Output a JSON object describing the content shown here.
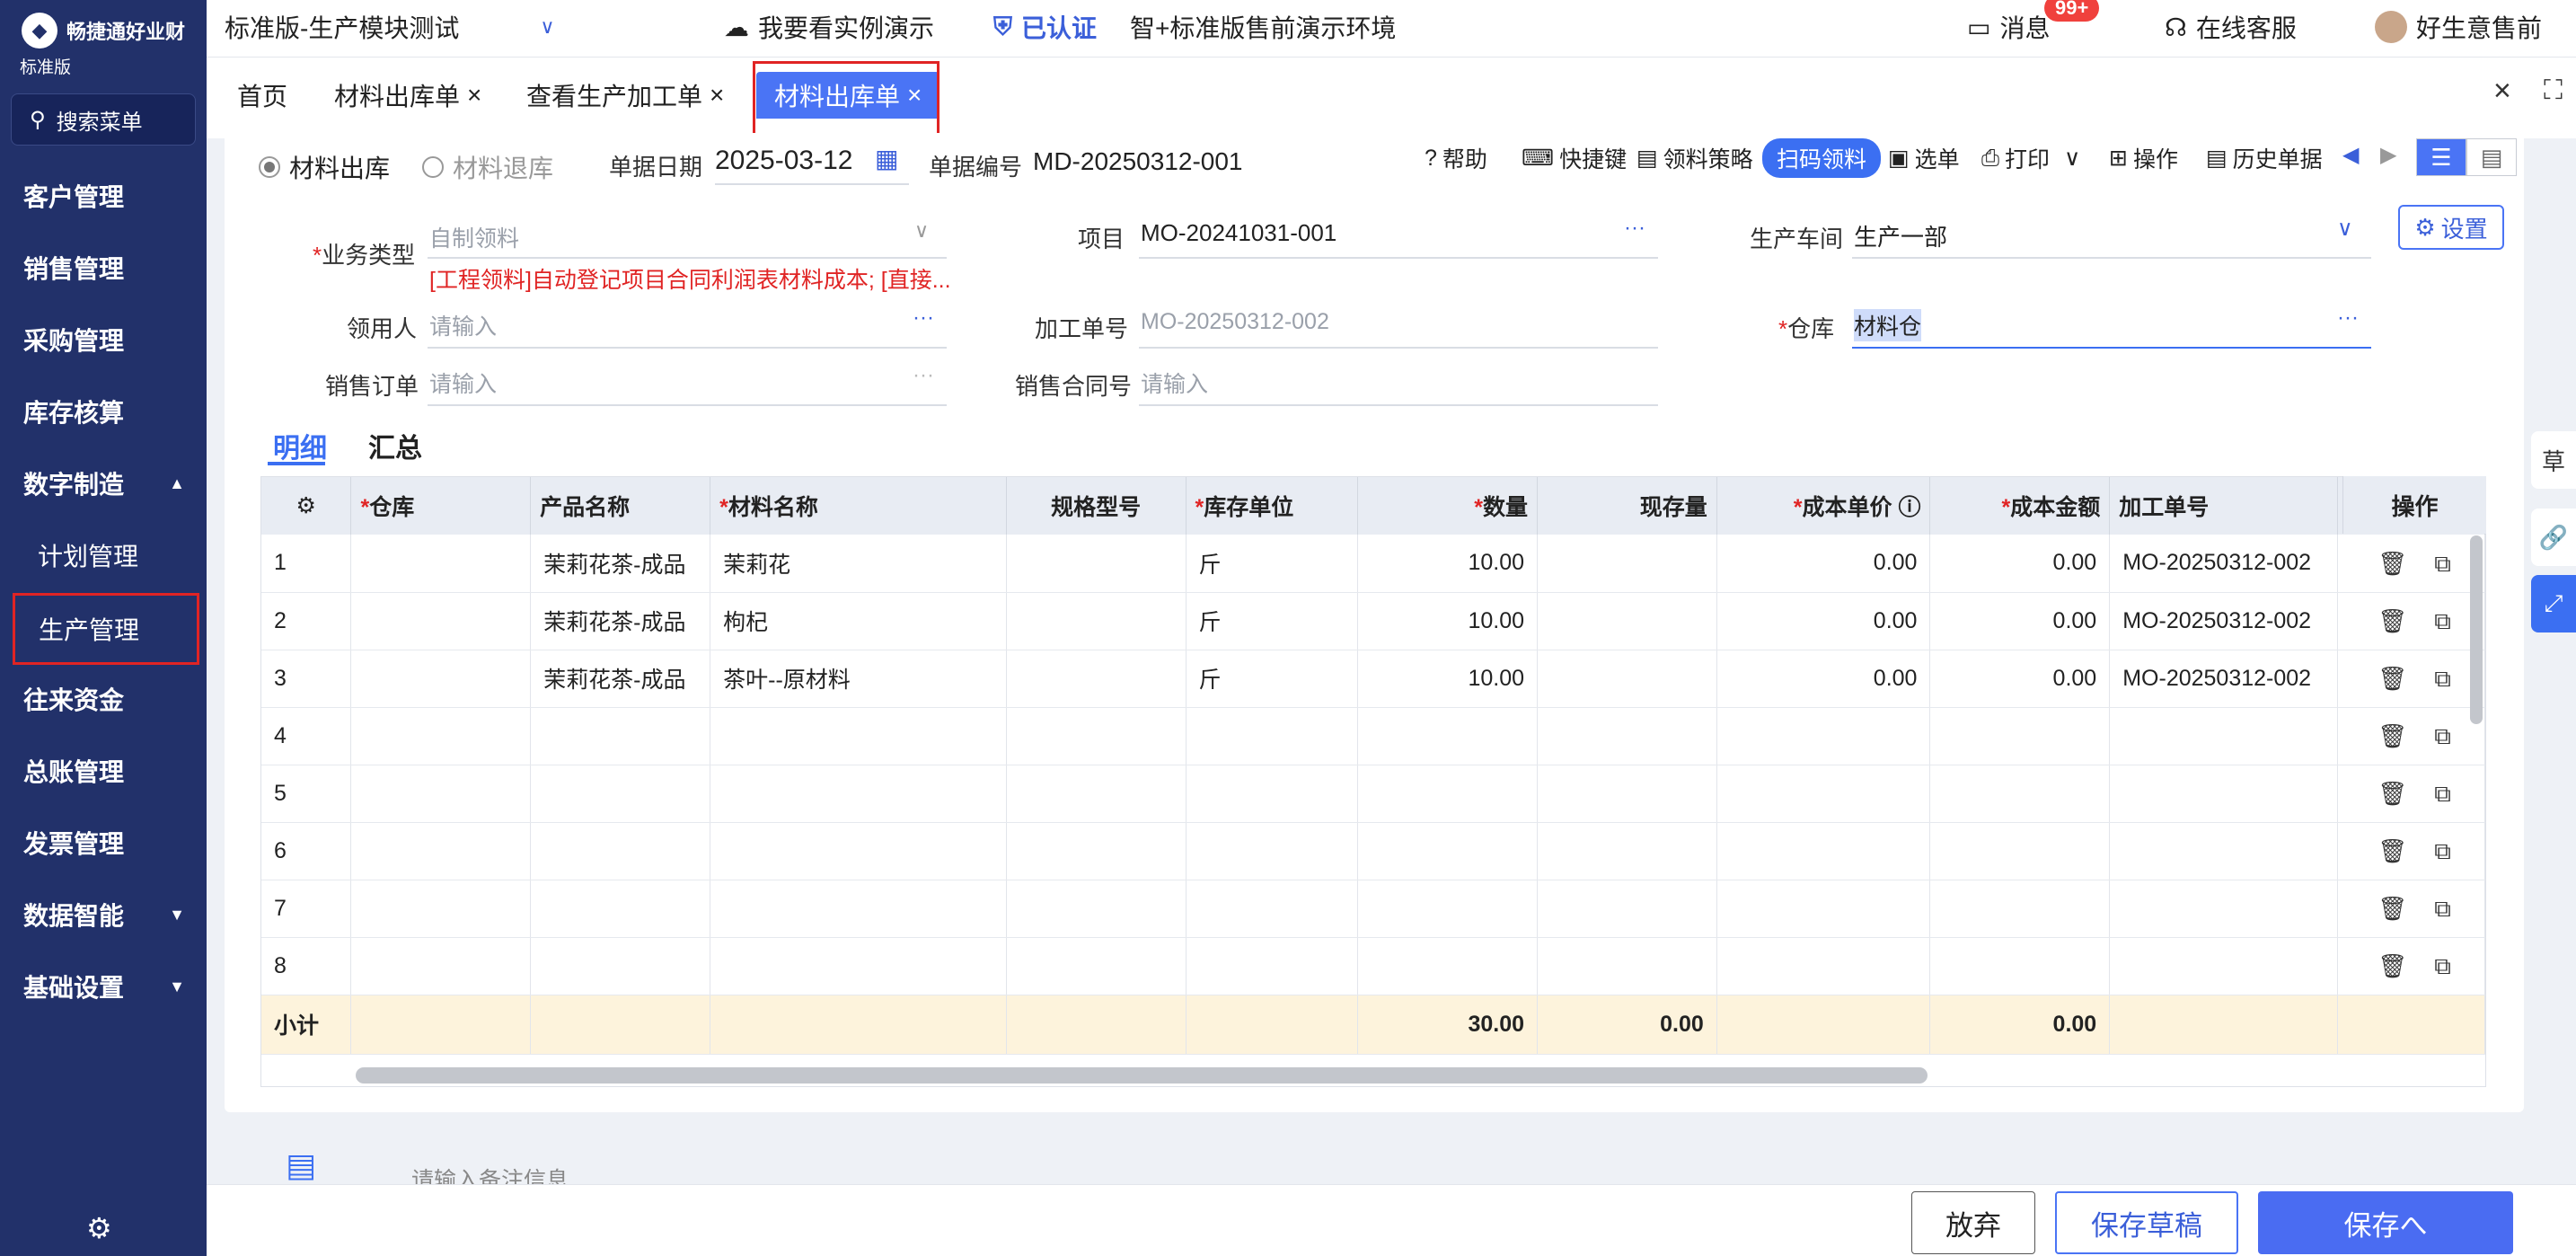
{
  "app": {
    "brand": "畅捷通好业财",
    "edition": "标准版"
  },
  "sidebar": {
    "search_label": "搜索菜单",
    "items": [
      {
        "label": "客户管理"
      },
      {
        "label": "销售管理"
      },
      {
        "label": "采购管理"
      },
      {
        "label": "库存核算"
      },
      {
        "label": "数字制造",
        "expanded": true
      },
      {
        "label": "计划管理"
      },
      {
        "label": "生产管理",
        "selected": true
      },
      {
        "label": "往来资金"
      },
      {
        "label": "总账管理"
      },
      {
        "label": "发票管理"
      },
      {
        "label": "数据智能"
      },
      {
        "label": "基础设置"
      }
    ]
  },
  "topbar": {
    "account": "标准版-生产模块测试",
    "demo": "我要看实例演示",
    "certified": "已认证",
    "env": "智+标准版售前演示环境",
    "messages": "消息",
    "messages_badge": "99+",
    "support": "在线客服",
    "user": "好生意售前"
  },
  "tabs": [
    {
      "label": "首页"
    },
    {
      "label": "材料出库单"
    },
    {
      "label": "查看生产加工单"
    },
    {
      "label": "材料出库单",
      "active": true
    }
  ],
  "form": {
    "radio_out": "材料出库",
    "radio_return": "材料退库",
    "date_label": "单据日期",
    "date_value": "2025-03-12",
    "code_label": "单据编号",
    "code_value": "MD-20250312-001",
    "biz_type_label": "业务类型",
    "biz_type_value": "自制领料",
    "biz_type_hint": "[工程领料]自动登记项目合同利润表材料成本; [直接...",
    "project_label": "项目",
    "project_value": "MO-20241031-001",
    "workshop_label": "生产车间",
    "workshop_value": "生产一部",
    "picker_label": "领用人",
    "picker_placeholder": "请输入",
    "process_no_label": "加工单号",
    "process_no_value": "MO-20250312-002",
    "warehouse_label": "仓库",
    "warehouse_value": "材料仓",
    "sales_order_label": "销售订单",
    "sales_order_placeholder": "请输入",
    "sales_contract_label": "销售合同号",
    "sales_contract_placeholder": "请输入"
  },
  "toolbar": {
    "help": "帮助",
    "shortcut": "快捷键",
    "strategy": "领料策略",
    "scan": "扫码领料",
    "select": "选单",
    "print": "打印",
    "operate": "操作",
    "history": "历史单据",
    "settings": "设置"
  },
  "subtabs": {
    "detail": "明细",
    "summary": "汇总"
  },
  "table": {
    "headers": [
      "仓库",
      "产品名称",
      "材料名称",
      "规格型号",
      "库存单位",
      "数量",
      "现存量",
      "成本单价",
      "成本金额",
      "加工单号",
      "操作"
    ],
    "rows": [
      {
        "no": "1",
        "warehouse": "",
        "product": "茉莉花茶-成品",
        "material": "茉莉花",
        "spec": "",
        "unit": "斤",
        "qty": "10.00",
        "stock": "",
        "price": "0.00",
        "amount": "0.00",
        "order": "MO-20250312-002"
      },
      {
        "no": "2",
        "warehouse": "",
        "product": "茉莉花茶-成品",
        "material": "枸杞",
        "spec": "",
        "unit": "斤",
        "qty": "10.00",
        "stock": "",
        "price": "0.00",
        "amount": "0.00",
        "order": "MO-20250312-002"
      },
      {
        "no": "3",
        "warehouse": "",
        "product": "茉莉花茶-成品",
        "material": "茶叶--原材料",
        "spec": "",
        "unit": "斤",
        "qty": "10.00",
        "stock": "",
        "price": "0.00",
        "amount": "0.00",
        "order": "MO-20250312-002"
      },
      {
        "no": "4",
        "warehouse": "",
        "product": "",
        "material": "",
        "spec": "",
        "unit": "",
        "qty": "",
        "stock": "",
        "price": "",
        "amount": "",
        "order": ""
      },
      {
        "no": "5",
        "warehouse": "",
        "product": "",
        "material": "",
        "spec": "",
        "unit": "",
        "qty": "",
        "stock": "",
        "price": "",
        "amount": "",
        "order": ""
      },
      {
        "no": "6",
        "warehouse": "",
        "product": "",
        "material": "",
        "spec": "",
        "unit": "",
        "qty": "",
        "stock": "",
        "price": "",
        "amount": "",
        "order": ""
      },
      {
        "no": "7",
        "warehouse": "",
        "product": "",
        "material": "",
        "spec": "",
        "unit": "",
        "qty": "",
        "stock": "",
        "price": "",
        "amount": "",
        "order": ""
      },
      {
        "no": "8",
        "warehouse": "",
        "product": "",
        "material": "",
        "spec": "",
        "unit": "",
        "qty": "",
        "stock": "",
        "price": "",
        "amount": "",
        "order": ""
      }
    ],
    "subtotal_label": "小计",
    "subtotal_qty": "30.00",
    "subtotal_stock": "0.00",
    "subtotal_amount": "0.00"
  },
  "note_placeholder": "请输入备注信息",
  "buttons": {
    "discard": "放弃",
    "draft": "保存草稿",
    "save": "保存へ"
  },
  "right_float": {
    "draft_label": "草"
  }
}
